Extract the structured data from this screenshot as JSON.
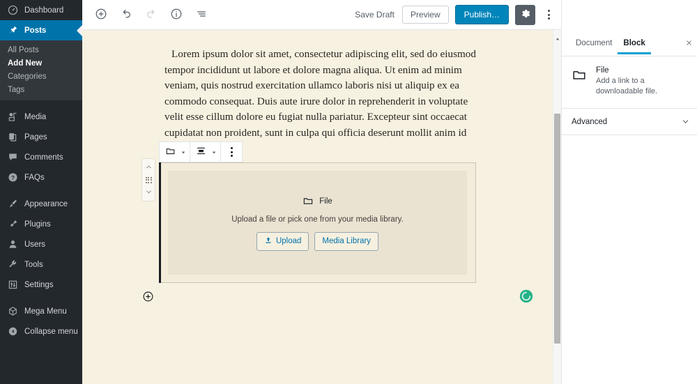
{
  "admin_sidebar": {
    "items": [
      {
        "label": "Dashboard",
        "icon": "dashboard-icon",
        "current": false
      },
      {
        "label": "Posts",
        "icon": "pin-icon",
        "current": true
      },
      {
        "label": "Media",
        "icon": "media-icon",
        "current": false
      },
      {
        "label": "Pages",
        "icon": "pages-icon",
        "current": false
      },
      {
        "label": "Comments",
        "icon": "comments-icon",
        "current": false
      },
      {
        "label": "FAQs",
        "icon": "question-icon",
        "current": false
      },
      {
        "label": "Appearance",
        "icon": "brush-icon",
        "current": false
      },
      {
        "label": "Plugins",
        "icon": "plug-icon",
        "current": false
      },
      {
        "label": "Users",
        "icon": "user-icon",
        "current": false
      },
      {
        "label": "Tools",
        "icon": "wrench-icon",
        "current": false
      },
      {
        "label": "Settings",
        "icon": "sliders-icon",
        "current": false
      },
      {
        "label": "Mega Menu",
        "icon": "cube-icon",
        "current": false
      },
      {
        "label": "Collapse menu",
        "icon": "collapse-icon",
        "current": false
      }
    ],
    "posts_submenu": [
      {
        "label": "All Posts",
        "active": false
      },
      {
        "label": "Add New",
        "active": true
      },
      {
        "label": "Categories",
        "active": false
      },
      {
        "label": "Tags",
        "active": false
      }
    ],
    "background_color": "#23282d",
    "current_color": "#0073aa"
  },
  "header": {
    "left_tools": [
      {
        "name": "add-block-button",
        "icon": "plus-circle-icon",
        "disabled": false
      },
      {
        "name": "undo-button",
        "icon": "undo-icon",
        "disabled": false
      },
      {
        "name": "redo-button",
        "icon": "redo-icon",
        "disabled": true
      },
      {
        "name": "content-info-button",
        "icon": "info-icon",
        "disabled": false
      },
      {
        "name": "block-navigation-button",
        "icon": "list-view-icon",
        "disabled": false
      }
    ],
    "save_draft_label": "Save Draft",
    "preview_label": "Preview",
    "publish_label": "Publish…",
    "settings_gear_icon": "gear-icon",
    "more_menu_icon": "vertical-dots-icon",
    "publish_color": "#0085ba"
  },
  "canvas": {
    "background_color": "#f7f1e1",
    "paragraph": "Lorem ipsum dolor sit amet, consectetur adipiscing elit, sed do eiusmod tempor incididunt ut labore et dolore magna aliqua. Ut enim ad minim veniam, quis nostrud exercitation ullamco laboris nisi ut aliquip ex ea commodo consequat. Duis aute irure dolor in reprehenderit in voluptate velit esse cillum dolore eu fugiat nulla pariatur. Excepteur sint occaecat cupidatat non proident, sunt in culpa qui officia deserunt mollit anim id est laborum.",
    "block_toolbar": [
      {
        "name": "block-type-button",
        "icon": "folder-icon",
        "has_caret": true
      },
      {
        "name": "align-button",
        "icon": "align-center-icon",
        "has_caret": true
      },
      {
        "name": "block-options-button",
        "icon": "vertical-dots-icon",
        "has_caret": false
      }
    ],
    "block_mover": {
      "move_up_icon": "chevron-up-icon",
      "drag_handle_icon": "drag-handle-icon",
      "move_down_icon": "chevron-down-icon"
    },
    "file_block": {
      "icon": "folder-icon",
      "label": "File",
      "instructions": "Upload a file or pick one from your media library.",
      "upload_label": "Upload",
      "upload_icon": "upload-icon",
      "media_library_label": "Media Library",
      "button_text_color": "#0073aa"
    },
    "default_appender_icon": "plus-circle-icon",
    "spinner": {
      "icon": "loading-spinner-icon",
      "color": "#26b289"
    }
  },
  "settings_sidebar": {
    "tabs": [
      {
        "label": "Document",
        "active": false
      },
      {
        "label": "Block",
        "active": true
      }
    ],
    "close_icon": "close-icon",
    "block_card": {
      "icon": "folder-icon",
      "title": "File",
      "description": "Add a link to a downloadable file."
    },
    "panels": [
      {
        "label": "Advanced",
        "chevron": "chevron-down-icon"
      }
    ],
    "active_tab_color": "#00a0d2"
  },
  "scrollbar": {
    "name": "canvas-scrollbar",
    "arrow_icon": "scroll-up-arrow-icon"
  }
}
